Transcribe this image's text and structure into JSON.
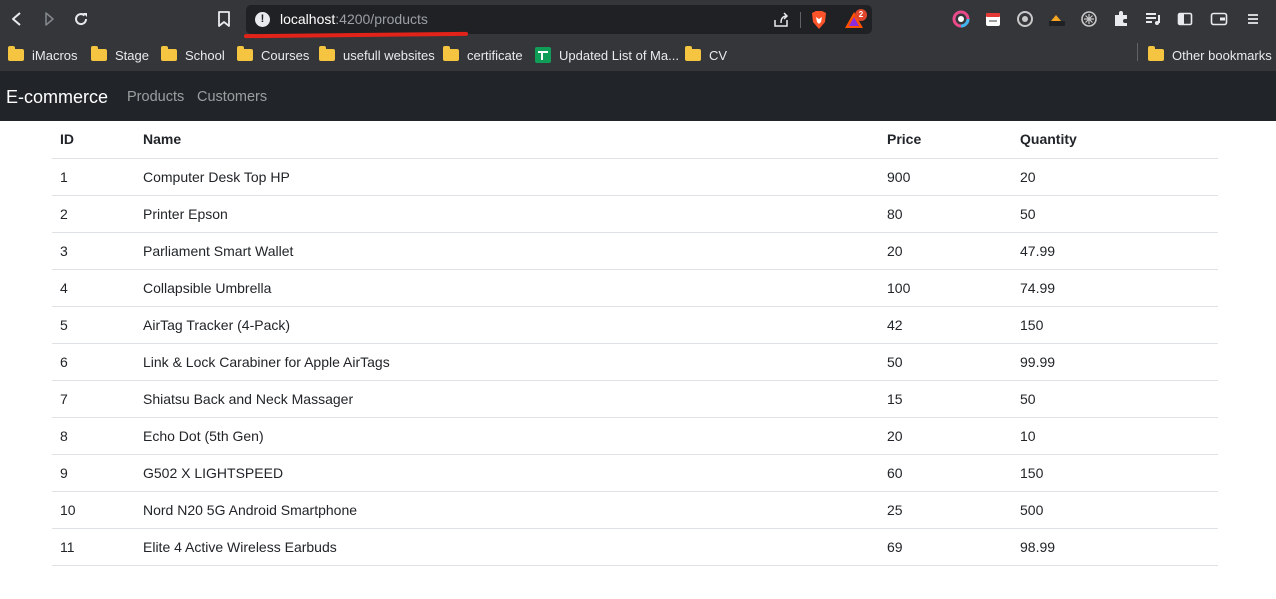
{
  "browser": {
    "url_host": "localhost",
    "url_path": ":4200/products",
    "rewards_badge": "2",
    "bookmarks": [
      {
        "label": "iMacros",
        "type": "folder"
      },
      {
        "label": "Stage",
        "type": "folder"
      },
      {
        "label": "School",
        "type": "folder"
      },
      {
        "label": "Courses",
        "type": "folder"
      },
      {
        "label": "usefull websites",
        "type": "folder"
      },
      {
        "label": "certificate",
        "type": "folder"
      },
      {
        "label": "Updated List of Ma...",
        "type": "sheet"
      },
      {
        "label": "CV",
        "type": "folder"
      }
    ],
    "other_bookmarks": "Other bookmarks"
  },
  "app": {
    "brand": "E-commerce",
    "nav": [
      "Products",
      "Customers"
    ]
  },
  "table": {
    "headers": [
      "ID",
      "Name",
      "Price",
      "Quantity"
    ],
    "rows": [
      [
        "1",
        "Computer Desk Top HP",
        "900",
        "20"
      ],
      [
        "2",
        "Printer Epson",
        "80",
        "50"
      ],
      [
        "3",
        "Parliament Smart Wallet",
        "20",
        "47.99"
      ],
      [
        "4",
        "Collapsible Umbrella",
        "100",
        "74.99"
      ],
      [
        "5",
        "AirTag Tracker (4-Pack)",
        "42",
        "150"
      ],
      [
        "6",
        "Link & Lock Carabiner for Apple AirTags",
        "50",
        "99.99"
      ],
      [
        "7",
        "Shiatsu Back and Neck Massager",
        "15",
        "50"
      ],
      [
        "8",
        "Echo Dot (5th Gen)",
        "20",
        "10"
      ],
      [
        "9",
        "G502 X LIGHTSPEED",
        "60",
        "150"
      ],
      [
        "10",
        "Nord N20 5G Android Smartphone",
        "25",
        "500"
      ],
      [
        "11",
        "Elite 4 Active Wireless Earbuds",
        "69",
        "98.99"
      ]
    ]
  },
  "colors": {
    "browser_chrome": "#35363a",
    "omnibox": "#202124",
    "navbar": "#212529",
    "annotation_underline": "#e2231a"
  }
}
